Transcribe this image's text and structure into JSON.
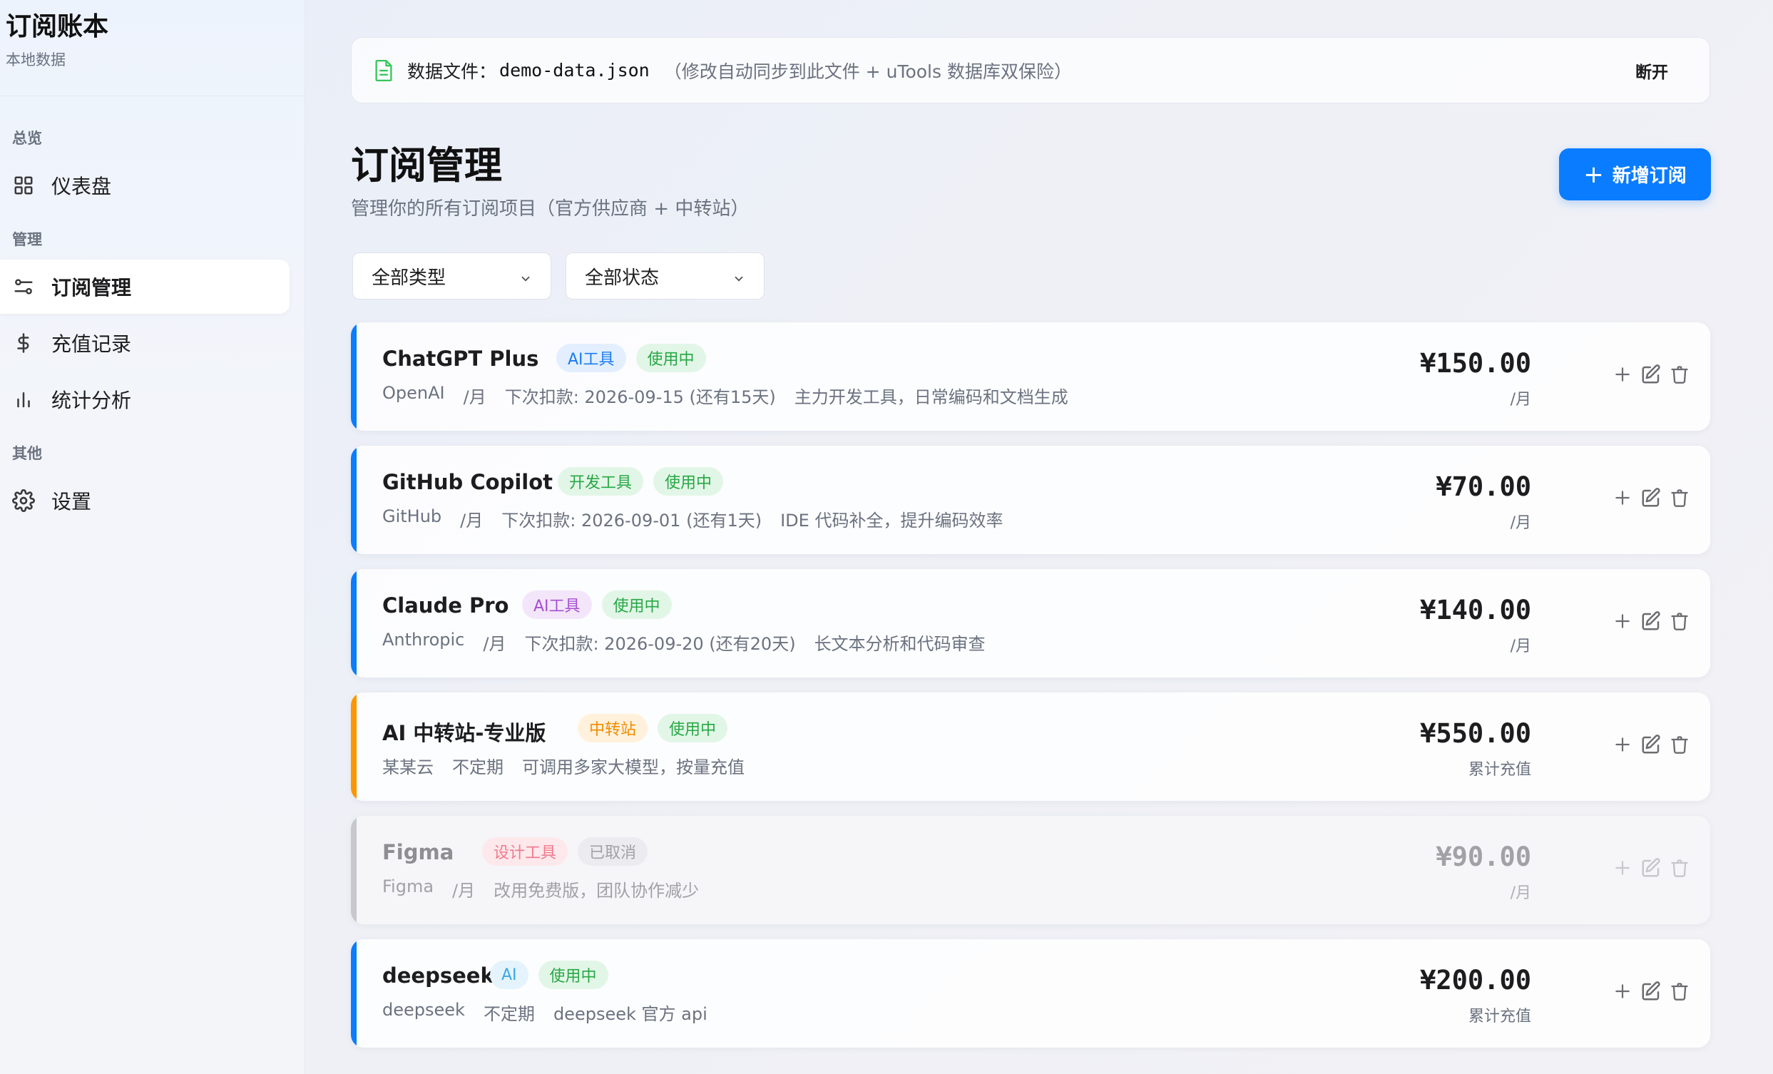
{
  "sidebar": {
    "app_title": "订阅账本",
    "app_subtitle": "本地数据",
    "sections": [
      {
        "label": "总览",
        "items": [
          {
            "label": "仪表盘",
            "icon": "grid-icon"
          }
        ]
      },
      {
        "label": "管理",
        "items": [
          {
            "label": "订阅管理",
            "icon": "sliders-icon",
            "active": true
          },
          {
            "label": "充值记录",
            "icon": "dollar-icon"
          },
          {
            "label": "统计分析",
            "icon": "bar-chart-icon"
          }
        ]
      },
      {
        "label": "其他",
        "items": [
          {
            "label": "设置",
            "icon": "gear-icon"
          }
        ]
      }
    ]
  },
  "banner": {
    "label": "数据文件：",
    "filename": "demo-data.json",
    "note": "（修改自动同步到此文件 + uTools 数据库双保险）",
    "disconnect": "断开",
    "icon": "file-icon"
  },
  "header": {
    "title": "订阅管理",
    "subtitle": "管理你的所有订阅项目（官方供应商 + 中转站）",
    "add_button": "新增订阅"
  },
  "filters": {
    "type": "全部类型",
    "status": "全部状态"
  },
  "colors": {
    "accent_blue": "#0a7cff",
    "accent_orange": "#ff9500",
    "accent_gray": "#c7c7cc",
    "status_green": "#34c759"
  },
  "subscriptions": [
    {
      "name": "ChatGPT Plus",
      "tags": [
        {
          "text": "AI工具",
          "color": "#1a7cf0",
          "bg": "#e3efff"
        },
        {
          "text": "使用中",
          "color": "#27a844",
          "bg": "#e2f6e7"
        }
      ],
      "provider": "OpenAI",
      "cycle": "/月",
      "next": "下次扣款: 2026-09-15 (还有15天)",
      "note": "主力开发工具，日常编码和文档生成",
      "price": "¥150.00",
      "unit": "/月",
      "accent": "#0a7cff",
      "state": "active"
    },
    {
      "name": "GitHub Copilot",
      "tags": [
        {
          "text": "开发工具",
          "color": "#27a844",
          "bg": "#e2f6e7"
        },
        {
          "text": "使用中",
          "color": "#27a844",
          "bg": "#e2f6e7"
        }
      ],
      "provider": "GitHub",
      "cycle": "/月",
      "next": "下次扣款: 2026-09-01 (还有1天)",
      "note": "IDE 代码补全，提升编码效率",
      "price": "¥70.00",
      "unit": "/月",
      "accent": "#0a7cff",
      "state": "active"
    },
    {
      "name": "Claude Pro",
      "tags": [
        {
          "text": "AI工具",
          "color": "#a64fd0",
          "bg": "#f3e6fb"
        },
        {
          "text": "使用中",
          "color": "#27a844",
          "bg": "#e2f6e7"
        }
      ],
      "provider": "Anthropic",
      "cycle": "/月",
      "next": "下次扣款: 2026-09-20 (还有20天)",
      "note": "长文本分析和代码审查",
      "price": "¥140.00",
      "unit": "/月",
      "accent": "#0a7cff",
      "state": "active"
    },
    {
      "name": "AI 中转站-专业版",
      "tags": [
        {
          "text": "中转站",
          "color": "#f08c00",
          "bg": "#fff1dc"
        },
        {
          "text": "使用中",
          "color": "#27a844",
          "bg": "#e2f6e7"
        }
      ],
      "provider": "某某云",
      "cycle": "不定期",
      "next": "",
      "note": "可调用多家大模型，按量充值",
      "price": "¥550.00",
      "unit": "累计充值",
      "accent": "#ff9500",
      "state": "active"
    },
    {
      "name": "Figma",
      "tags": [
        {
          "text": "设计工具",
          "color": "#f07a8c",
          "bg": "#fde8ec"
        },
        {
          "text": "已取消",
          "color": "#a1a1a6",
          "bg": "#ececf0"
        }
      ],
      "provider": "Figma",
      "cycle": "/月",
      "next": "",
      "note": "改用免费版，团队协作减少",
      "price": "¥90.00",
      "unit": "/月",
      "accent": "#c7c7cc",
      "state": "cancelled"
    },
    {
      "name": "deepseek",
      "tags": [
        {
          "text": "AI",
          "color": "#3aa8e6",
          "bg": "#e4f3fc"
        },
        {
          "text": "使用中",
          "color": "#27a844",
          "bg": "#e2f6e7"
        }
      ],
      "provider": "deepseek",
      "cycle": "不定期",
      "next": "",
      "note": "deepseek 官方 api",
      "price": "¥200.00",
      "unit": "累计充值",
      "accent": "#0a7cff",
      "state": "active"
    }
  ]
}
